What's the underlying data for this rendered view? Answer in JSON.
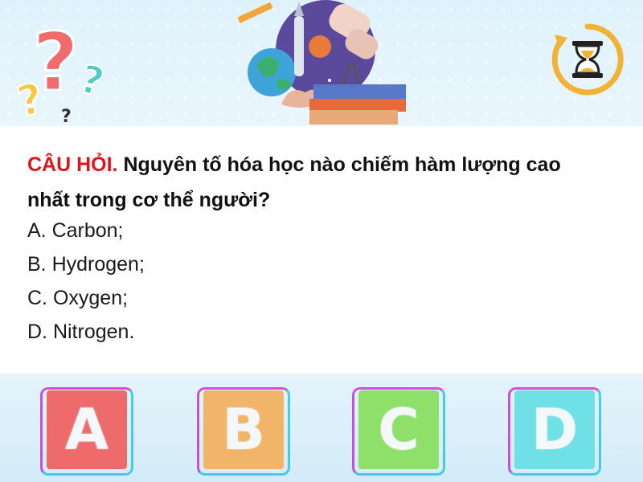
{
  "question": {
    "prefix": "CÂU HỎI.",
    "text": "Nguyên tố hóa học nào chiếm hàm lượng cao nhất trong cơ thể người?"
  },
  "options": [
    {
      "label": "A. Carbon;"
    },
    {
      "label": "B. Hydrogen;"
    },
    {
      "label": "C. Oxygen;"
    },
    {
      "label": "D. Nitrogen."
    }
  ],
  "answer_buttons": [
    {
      "letter": "A",
      "color": "#ef6b6b"
    },
    {
      "letter": "B",
      "color": "#f0b568"
    },
    {
      "letter": "C",
      "color": "#8ee06a"
    },
    {
      "letter": "D",
      "color": "#6ee0e6"
    }
  ],
  "icons": {
    "question_marks": "question-marks-icon",
    "science": "science-illustration-icon",
    "timer": "hourglass-timer-icon"
  },
  "colors": {
    "question_prefix": "#e0141b",
    "timer_ring": "#f2b233"
  }
}
